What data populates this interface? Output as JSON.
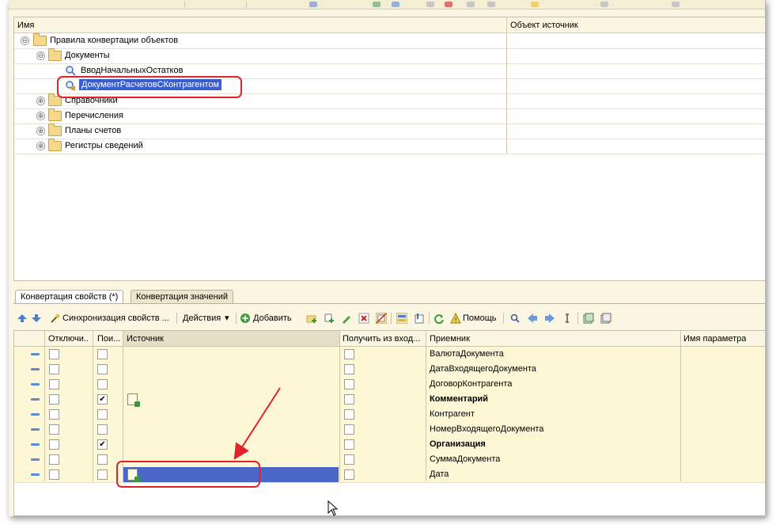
{
  "tree": {
    "columns": [
      "Имя",
      "Объект источник"
    ],
    "rows": [
      {
        "label": "Правила конвертации объектов",
        "toggle": "⊖",
        "kind": "folder",
        "level": 0
      },
      {
        "label": "Документы",
        "toggle": "⊖",
        "kind": "folder",
        "level": 1
      },
      {
        "label": "ВводНачальныхОстатков",
        "toggle": "",
        "kind": "rule",
        "level": 2
      },
      {
        "label": "ДокументРасчетовСКонтрагентом",
        "toggle": "",
        "kind": "rule",
        "level": 2,
        "selected": true
      },
      {
        "label": "Справочники",
        "toggle": "⊕",
        "kind": "folder",
        "level": 1
      },
      {
        "label": "Перечисления",
        "toggle": "⊕",
        "kind": "folder",
        "level": 1
      },
      {
        "label": "Планы счетов",
        "toggle": "⊕",
        "kind": "folder",
        "level": 1
      },
      {
        "label": "Регистры сведений",
        "toggle": "⊕",
        "kind": "folder",
        "level": 1
      }
    ]
  },
  "tabs": [
    {
      "label": "Конвертация свойств (*)",
      "active": true
    },
    {
      "label": "Конвертация значений",
      "active": false
    }
  ],
  "toolbar": {
    "sync_label": "Синхронизация свойств ...",
    "actions_label": "Действия",
    "add_label": "Добавить",
    "help_label": "Помощь"
  },
  "grid": {
    "columns": [
      "Отключи...",
      "Пои...",
      "Источник",
      "Получить из вход...",
      "Приемник",
      "Имя параметра"
    ],
    "rows": [
      {
        "disabled": false,
        "search": false,
        "source_icon": false,
        "get_from_in": false,
        "target": "ВалютаДокумента",
        "bold": false
      },
      {
        "disabled": false,
        "search": false,
        "source_icon": false,
        "get_from_in": false,
        "target": "ДатаВходящегоДокумента",
        "bold": false
      },
      {
        "disabled": false,
        "search": false,
        "source_icon": false,
        "get_from_in": false,
        "target": "ДоговорКонтрагента",
        "bold": false
      },
      {
        "disabled": false,
        "search": true,
        "source_icon": true,
        "get_from_in": false,
        "target": "Комментарий",
        "bold": true
      },
      {
        "disabled": false,
        "search": false,
        "source_icon": false,
        "get_from_in": false,
        "target": "Контрагент",
        "bold": false
      },
      {
        "disabled": false,
        "search": false,
        "source_icon": false,
        "get_from_in": false,
        "target": "НомерВходящегоДокумента",
        "bold": false
      },
      {
        "disabled": false,
        "search": true,
        "source_icon": false,
        "get_from_in": false,
        "target": "Организация",
        "bold": true
      },
      {
        "disabled": false,
        "search": false,
        "source_icon": false,
        "get_from_in": false,
        "target": "СуммаДокумента",
        "bold": false
      },
      {
        "disabled": false,
        "search": false,
        "source_icon": true,
        "get_from_in": false,
        "target": "Дата",
        "bold": false,
        "selected": true
      }
    ]
  },
  "colors": {
    "selection": "#3a5fcd",
    "annotation": "#e0222a",
    "row_bg": "#fdf7d6"
  }
}
